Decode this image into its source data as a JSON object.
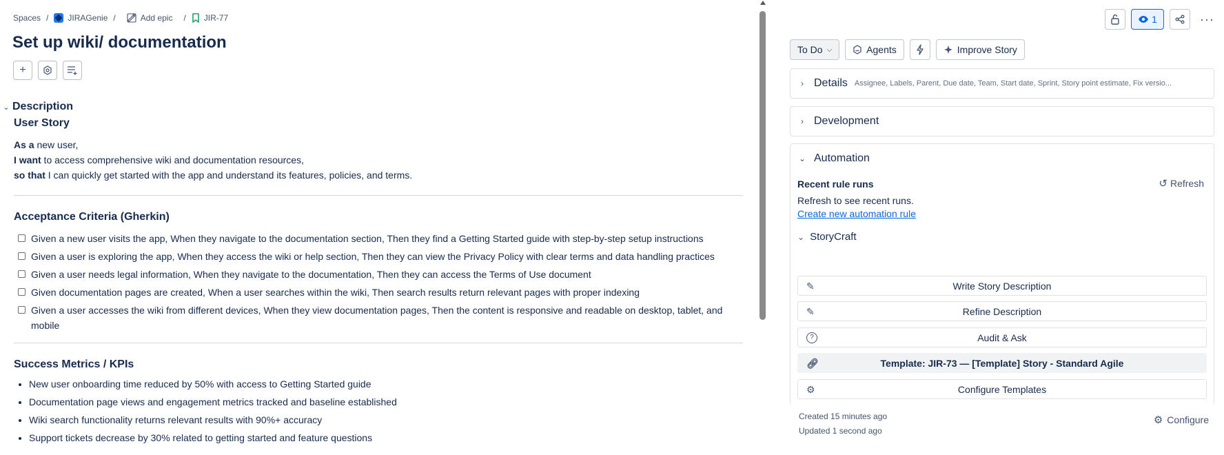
{
  "breadcrumb": {
    "spaces": "Spaces",
    "project": "JIRAGenie",
    "epic": "Add epic",
    "key": "JIR-77"
  },
  "issue": {
    "title": "Set up wiki/ documentation"
  },
  "description": {
    "heading": "Description",
    "user_story_heading": "User Story",
    "lines": [
      {
        "bold": "As a",
        "text": " new user,"
      },
      {
        "bold": "I want",
        "text": " to access comprehensive wiki and documentation resources,"
      },
      {
        "bold": "so that",
        "text": " I can quickly get started with the app and understand its features, policies, and terms."
      }
    ],
    "acceptance_heading": "Acceptance Criteria (Gherkin)",
    "acceptance": [
      "Given a new user visits the app, When they navigate to the documentation section, Then they find a Getting Started guide with step-by-step setup instructions",
      "Given a user is exploring the app, When they access the wiki or help section, Then they can view the Privacy Policy with clear terms and data handling practices",
      "Given a user needs legal information, When they navigate to the documentation, Then they can access the Terms of Use document",
      "Given documentation pages are created, When a user searches within the wiki, Then search results return relevant pages with proper indexing",
      "Given a user accesses the wiki from different devices, When they view documentation pages, Then the content is responsive and readable on desktop, tablet, and mobile"
    ],
    "metrics_heading": "Success Metrics / KPIs",
    "metrics": [
      "New user onboarding time reduced by 50% with access to Getting Started guide",
      "Documentation page views and engagement metrics tracked and baseline established",
      "Wiki search functionality returns relevant results with 90%+ accuracy",
      "Support tickets decrease by 30% related to getting started and feature questions"
    ]
  },
  "sidebar": {
    "watch_count": "1",
    "status": "To Do",
    "agents": "Agents",
    "improve": "Improve Story",
    "details_title": "Details",
    "details_sub": "Assignee, Labels, Parent, Due date, Team, Start date, Sprint, Story point estimate, Fix versio...",
    "development_title": "Development",
    "automation_title": "Automation",
    "recent_runs": "Recent rule runs",
    "refresh": "Refresh",
    "refresh_text": "Refresh to see recent runs.",
    "create_rule": "Create new automation rule",
    "storycraft": "StoryCraft",
    "buttons": {
      "write": "Write Story Description",
      "refine": "Refine Description",
      "audit": "Audit & Ask",
      "template": "Template: JIR-73 — [Template] Story - Standard Agile",
      "configure_templates": "Configure Templates"
    },
    "created": "Created 15 minutes ago",
    "updated": "Updated 1 second ago",
    "configure": "Configure"
  }
}
